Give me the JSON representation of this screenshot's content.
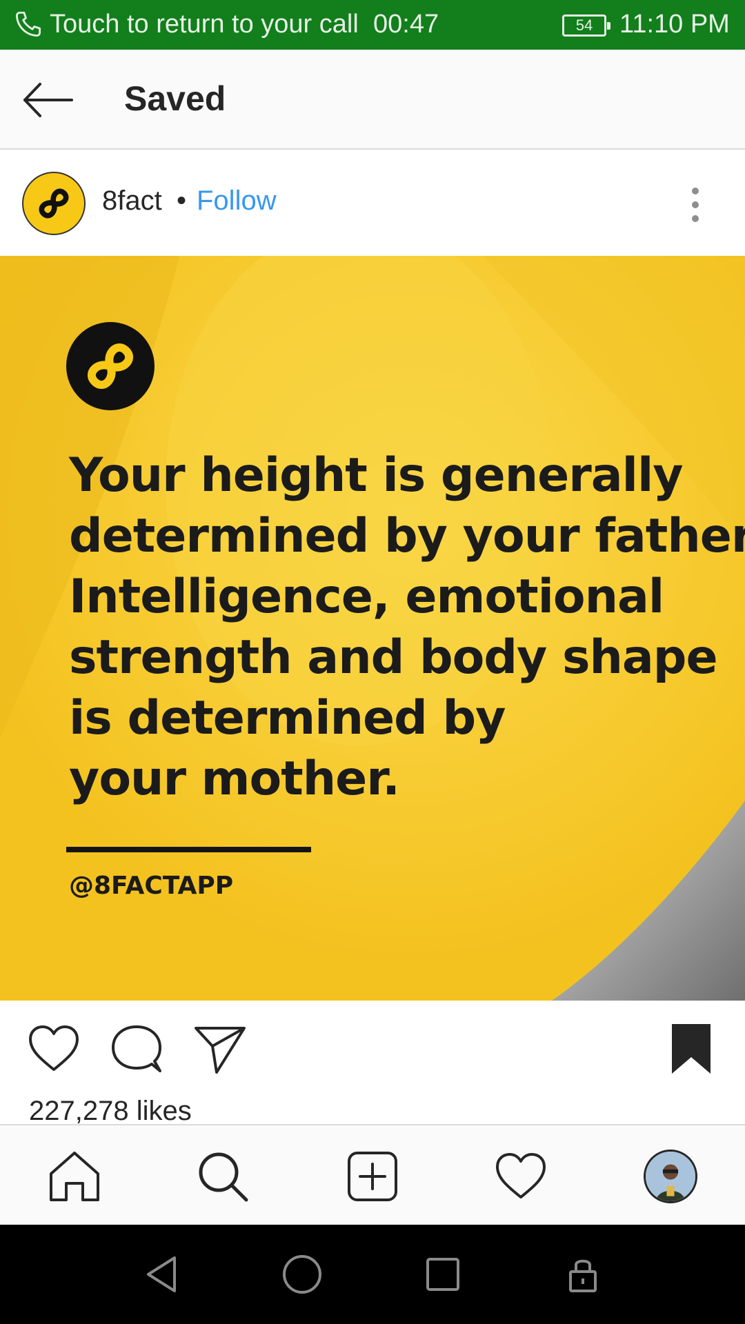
{
  "status_bar": {
    "call_text": "Touch to return to your call",
    "call_timer": "00:47",
    "battery": "54",
    "time": "11:10 PM",
    "background_color": "#127e1c"
  },
  "header": {
    "back_icon": "arrow-left-icon",
    "title": "Saved"
  },
  "post": {
    "username": "8fact",
    "separator": "•",
    "follow_label": "Follow",
    "more_icon": "more-vertical-icon",
    "image": {
      "lines": [
        "Your height is generally",
        "determined by your father.",
        "Intelligence, emotional",
        "strength and body shape",
        "is determined by",
        "your mother."
      ],
      "handle": "@8FACTAPP",
      "background_color": "#f7cc2c"
    },
    "actions": {
      "like_icon": "heart-outline-icon",
      "comment_icon": "comment-icon",
      "share_icon": "send-icon",
      "save_icon": "bookmark-filled-icon"
    },
    "likes": "227,278 likes"
  },
  "bottom_nav": {
    "items": [
      "home-icon",
      "search-icon",
      "add-post-icon",
      "activity-heart-icon",
      "profile-avatar"
    ]
  },
  "system_nav": {
    "items": [
      "back-triangle-icon",
      "home-circle-icon",
      "recents-square-icon",
      "lock-icon"
    ]
  }
}
